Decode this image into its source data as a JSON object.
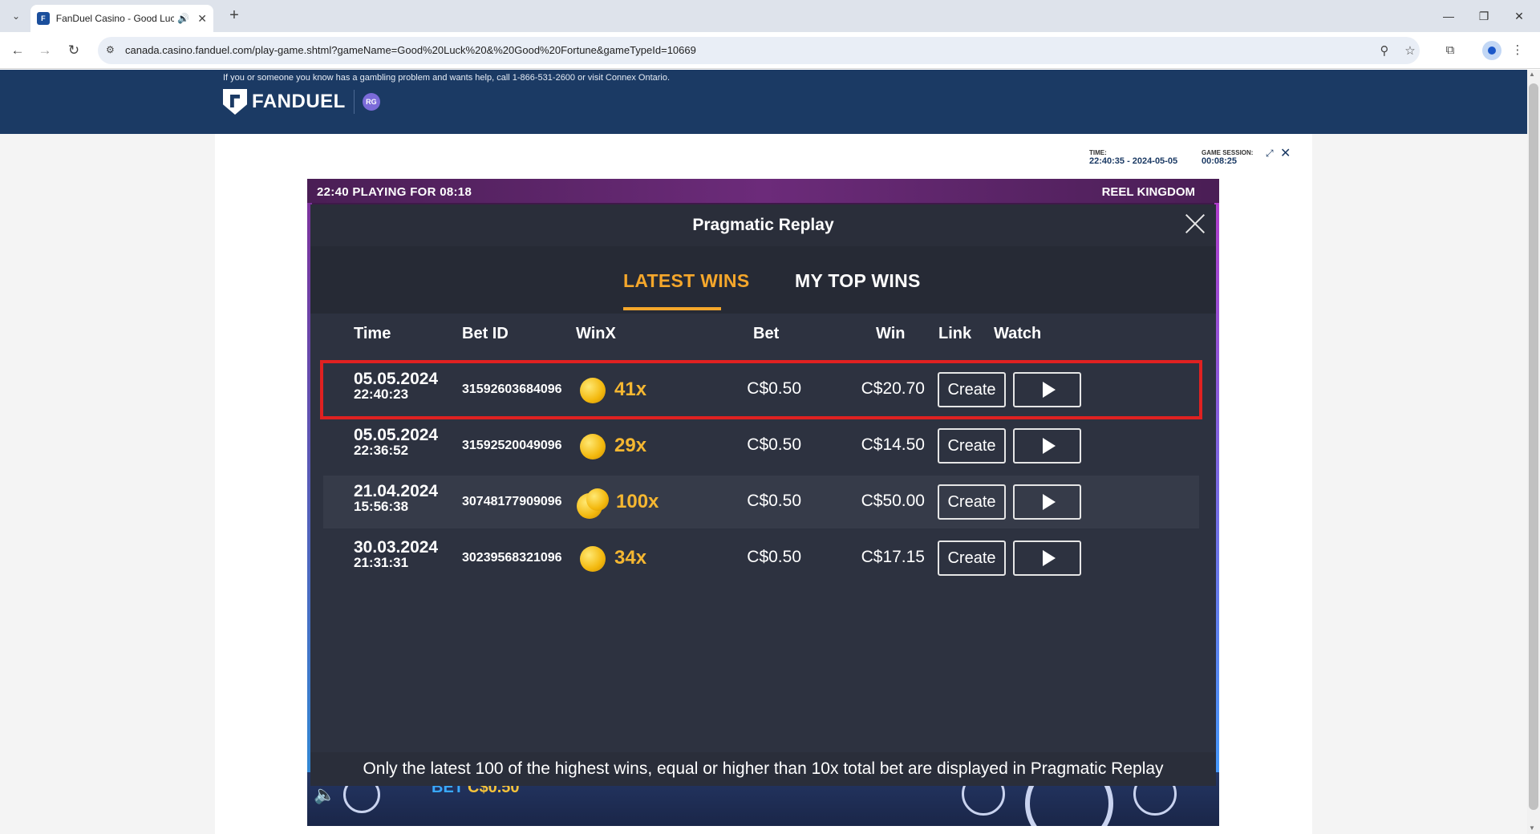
{
  "browser": {
    "tab_title": "FanDuel Casino - Good Luc",
    "url": "canada.casino.fanduel.com/play-game.shtml?gameName=Good%20Luck%20&%20Good%20Fortune&gameTypeId=10669"
  },
  "header": {
    "rg_notice": "If you or someone you know has a gambling problem and wants help, call 1-866-531-2600 or visit Connex Ontario.",
    "brand": "FANDUEL",
    "rg_badge": "RG"
  },
  "session": {
    "time_label": "TIME:",
    "time_value": "22:40:35 - 2024-05-05",
    "session_label": "GAME SESSION:",
    "session_value": "00:08:25"
  },
  "game": {
    "clock": "22:40  PLAYING FOR 08:18",
    "provider": "REEL KINGDOM",
    "bet_label": "BET",
    "bet_value": "C$0.50"
  },
  "modal": {
    "title": "Pragmatic Replay",
    "tabs": {
      "latest": "LATEST WINS",
      "top": "MY TOP WINS"
    },
    "columns": {
      "time": "Time",
      "bet_id": "Bet ID",
      "winx": "WinX",
      "bet": "Bet",
      "win": "Win",
      "link": "Link",
      "watch": "Watch"
    },
    "rows": [
      {
        "date": "05.05.2024",
        "time": "22:40:23",
        "bet_id": "31592603684096",
        "winx": "41x",
        "bet": "C$0.50",
        "win": "C$20.70",
        "create": "Create"
      },
      {
        "date": "05.05.2024",
        "time": "22:36:52",
        "bet_id": "31592520049096",
        "winx": "29x",
        "bet": "C$0.50",
        "win": "C$14.50",
        "create": "Create"
      },
      {
        "date": "21.04.2024",
        "time": "15:56:38",
        "bet_id": "30748177909096",
        "winx": "100x",
        "bet": "C$0.50",
        "win": "C$50.00",
        "create": "Create"
      },
      {
        "date": "30.03.2024",
        "time": "21:31:31",
        "bet_id": "30239568321096",
        "winx": "34x",
        "bet": "C$0.50",
        "win": "C$17.15",
        "create": "Create"
      }
    ],
    "footer": "Only the latest 100 of the highest wins, equal or higher than 10x total bet are displayed in Pragmatic Replay"
  }
}
